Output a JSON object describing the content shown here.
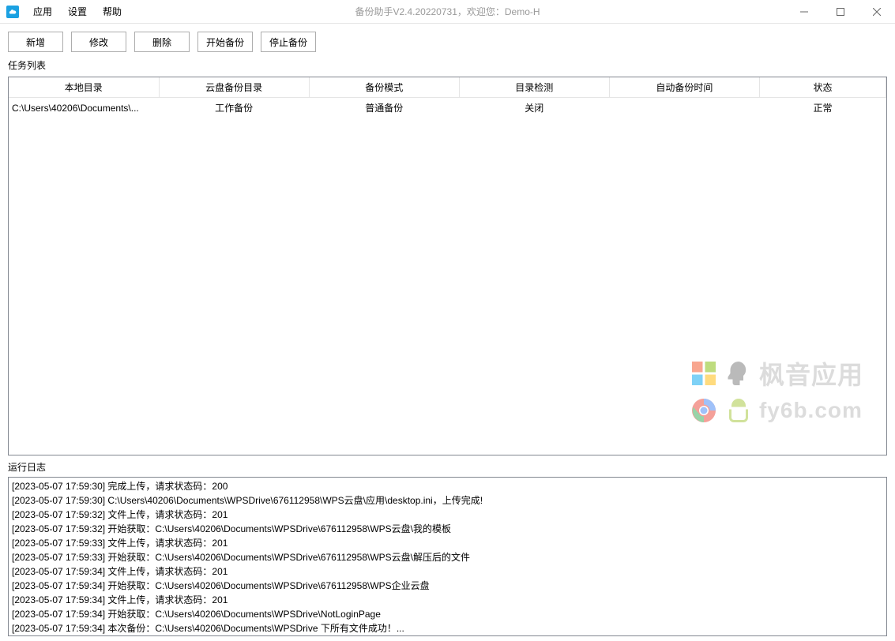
{
  "window": {
    "title": "备份助手V2.4.20220731，欢迎您：Demo-H"
  },
  "menus": [
    "应用",
    "设置",
    "帮助"
  ],
  "toolbar": {
    "new": "新增",
    "edit": "修改",
    "delete": "删除",
    "start": "开始备份",
    "stop": "停止备份"
  },
  "task_list_label": "任务列表",
  "table": {
    "headers": [
      "本地目录",
      "云盘备份目录",
      "备份模式",
      "目录检测",
      "自动备份时间",
      "状态"
    ],
    "rows": [
      {
        "local_dir": "C:\\Users\\40206\\Documents\\...",
        "cloud_dir": "工作备份",
        "mode": "普通备份",
        "detect": "关闭",
        "auto_time": "",
        "status": "正常"
      }
    ]
  },
  "log_label": "运行日志",
  "logs": [
    "[2023-05-07 17:59:30] 完成上传，请求状态码：200",
    "[2023-05-07 17:59:30] C:\\Users\\40206\\Documents\\WPSDrive\\676112958\\WPS云盘\\应用\\desktop.ini，上传完成!",
    "[2023-05-07 17:59:32] 文件上传，请求状态码：201",
    "[2023-05-07 17:59:32] 开始获取：C:\\Users\\40206\\Documents\\WPSDrive\\676112958\\WPS云盘\\我的模板",
    "[2023-05-07 17:59:33] 文件上传，请求状态码：201",
    "[2023-05-07 17:59:33] 开始获取：C:\\Users\\40206\\Documents\\WPSDrive\\676112958\\WPS云盘\\解压后的文件",
    "[2023-05-07 17:59:34] 文件上传，请求状态码：201",
    "[2023-05-07 17:59:34] 开始获取：C:\\Users\\40206\\Documents\\WPSDrive\\676112958\\WPS企业云盘",
    "[2023-05-07 17:59:34] 文件上传，请求状态码：201",
    "[2023-05-07 17:59:34] 开始获取：C:\\Users\\40206\\Documents\\WPSDrive\\NotLoginPage",
    "[2023-05-07 17:59:34] 本次备份：C:\\Users\\40206\\Documents\\WPSDrive 下所有文件成功！..."
  ],
  "watermark": {
    "line1": "枫音应用",
    "line2": "fy6b.com"
  }
}
